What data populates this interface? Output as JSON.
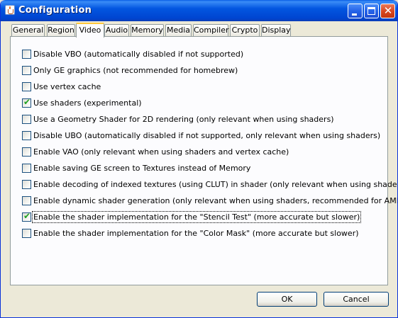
{
  "window": {
    "title": "Configuration"
  },
  "tabs": [
    {
      "label": "General"
    },
    {
      "label": "Region"
    },
    {
      "label": "Video",
      "active": true
    },
    {
      "label": "Audio"
    },
    {
      "label": "Memory"
    },
    {
      "label": "Media"
    },
    {
      "label": "Compiler"
    },
    {
      "label": "Crypto"
    },
    {
      "label": "Display"
    }
  ],
  "options": [
    {
      "label": "Disable VBO (automatically disabled if not supported)",
      "checked": false
    },
    {
      "label": "Only GE graphics (not recommended for homebrew)",
      "checked": false
    },
    {
      "label": "Use vertex cache",
      "checked": false
    },
    {
      "label": "Use shaders (experimental)",
      "checked": true
    },
    {
      "label": "Use a Geometry Shader for 2D rendering (only relevant when using shaders)",
      "checked": false
    },
    {
      "label": "Disable UBO (automatically disabled if not supported, only relevant when using shaders)",
      "checked": false
    },
    {
      "label": "Enable VAO (only relevant when using shaders and vertex cache)",
      "checked": false
    },
    {
      "label": "Enable saving GE screen to Textures instead of Memory",
      "checked": false
    },
    {
      "label": "Enable decoding of indexed textures (using CLUT) in shader (only relevant when using shaders)",
      "checked": false
    },
    {
      "label": "Enable dynamic shader generation (only relevant when using shaders, recommended for AMD/ATI)",
      "checked": false
    },
    {
      "label": "Enable the shader implementation for the \"Stencil Test\" (more accurate but slower)",
      "checked": true,
      "focused": true
    },
    {
      "label": "Enable the shader implementation for the \"Color Mask\" (more accurate but slower)",
      "checked": false
    }
  ],
  "buttons": {
    "ok": "OK",
    "cancel": "Cancel"
  }
}
